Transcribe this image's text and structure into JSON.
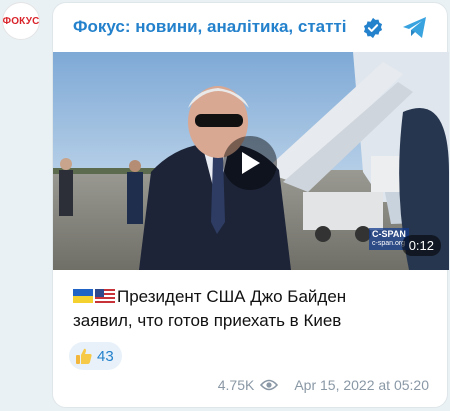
{
  "avatar": {
    "text": "ФОКУС"
  },
  "channel": {
    "title": "Фокус: новини, аналітика, статті",
    "verified": true,
    "source_icon": "telegram-icon"
  },
  "video": {
    "duration": "0:12",
    "watermark": "C-SPAN",
    "watermark_sub": "c-span.org",
    "play_icon": "play-icon"
  },
  "post": {
    "flags": [
      "ukraine-flag",
      "usa-flag"
    ],
    "text_line1": "Президент США Джо Байден",
    "text_line2": "заявил, что готов приехать в Киев"
  },
  "reaction": {
    "emoji": "thumbs-up",
    "count": "43"
  },
  "footer": {
    "views": "4.75K",
    "date": "Apr 15, 2022 at 05:20"
  },
  "colors": {
    "accent": "#2481cc",
    "muted": "#8a98a6",
    "background": "#e9f1f5"
  }
}
